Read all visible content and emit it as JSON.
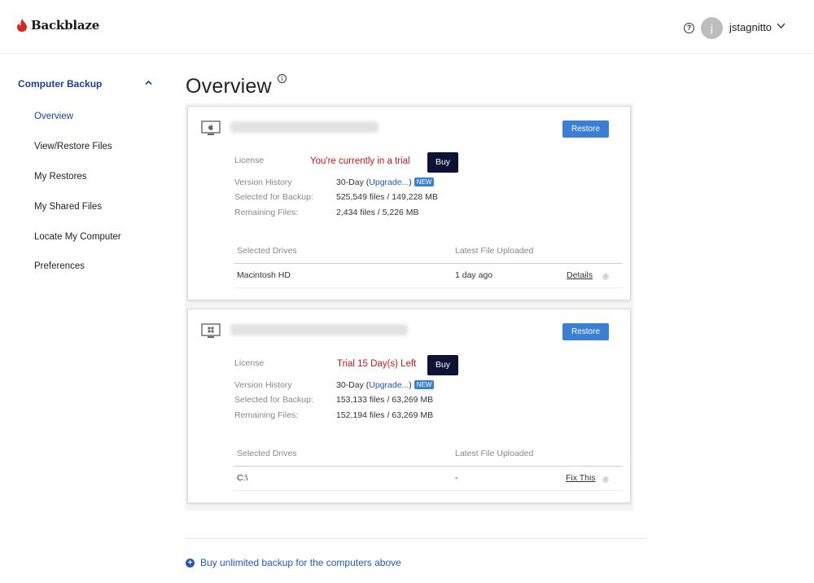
{
  "brand": {
    "name": "Backblaze",
    "logo_color": "#d6281e"
  },
  "header": {
    "help_icon": "question-circle-icon",
    "help_glyph": "?",
    "avatar_initial": "j",
    "username": "jstagnitto"
  },
  "sidebar": {
    "section_label": "Computer Backup",
    "items": [
      {
        "label": "Overview",
        "active": true
      },
      {
        "label": "View/Restore Files",
        "active": false
      },
      {
        "label": "My Restores",
        "active": false
      },
      {
        "label": "My Shared Files",
        "active": false
      },
      {
        "label": "Locate My Computer",
        "active": false
      },
      {
        "label": "Preferences",
        "active": false
      }
    ]
  },
  "main": {
    "title": "Overview",
    "title_info_glyph": "i",
    "computers": [
      {
        "os_icon": "apple-monitor-icon",
        "restore_label": "Restore",
        "license_label": "License",
        "license_status": "You're currently in a trial",
        "buy_label": "Buy",
        "version_history_label": "Version History",
        "version_history_value": "30-Day (",
        "upgrade_label": "Upgrade...",
        "version_history_close": ")",
        "new_badge": "NEW",
        "selected_label": "Selected for Backup:",
        "selected_value": "525,549 files / 149,228 MB",
        "remaining_label": "Remaining Files:",
        "remaining_value": "2,434 files / 5,226 MB",
        "drives_header": "Selected Drives",
        "uploaded_header": "Latest File Uploaded",
        "drives": [
          {
            "name": "Macintosh HD",
            "last_upload": "1 day ago",
            "action": "Details"
          }
        ]
      },
      {
        "os_icon": "windows-monitor-icon",
        "restore_label": "Restore",
        "license_label": "License",
        "license_status": "Trial 15 Day(s) Left",
        "buy_label": "Buy",
        "version_history_label": "Version History",
        "version_history_value": "30-Day (",
        "upgrade_label": "Upgrade...",
        "version_history_close": ")",
        "new_badge": "NEW",
        "selected_label": "Selected for Backup:",
        "selected_value": "153,133 files / 63,269 MB",
        "remaining_label": "Remaining Files:",
        "remaining_value": "152,194 files / 63,269 MB",
        "drives_header": "Selected Drives",
        "uploaded_header": "Latest File Uploaded",
        "drives": [
          {
            "name": "C:\\",
            "last_upload": "-",
            "action": "Fix This"
          }
        ]
      }
    ],
    "buy_more_label": "Buy unlimited backup for the computers above"
  },
  "colors": {
    "accent": "#1a3f8f",
    "button_blue": "#3a7fd5",
    "trial_red": "#c0181f",
    "buy_dark": "#0e1335",
    "link_blue": "#2456b8"
  }
}
